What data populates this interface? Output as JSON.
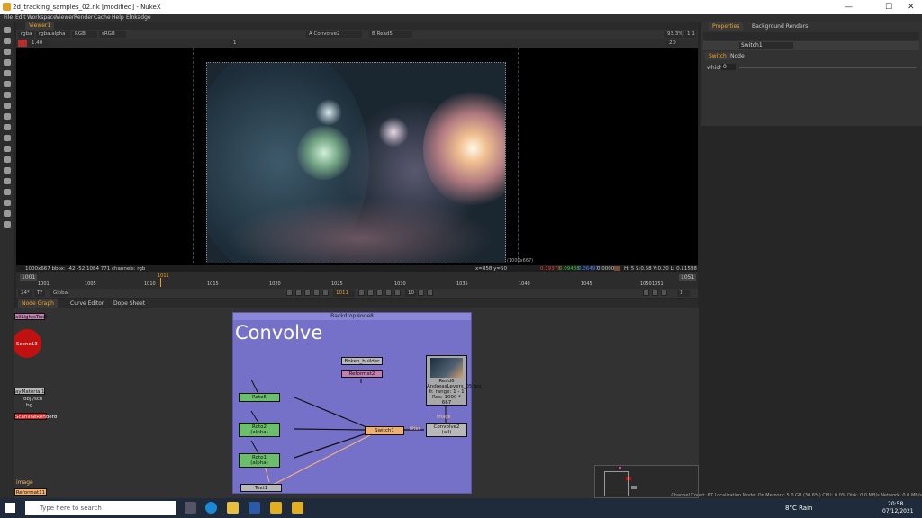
{
  "window": {
    "title": "2d_tracking_samples_02.nk [modified] - NukeX",
    "minimize": "—",
    "maximize": "☐",
    "close": "✕"
  },
  "menu": [
    "File",
    "Edit",
    "Workspace",
    "Viewer",
    "Render",
    "Cache",
    "Help",
    "Elnkadge"
  ],
  "viewer": {
    "tab": "Viewer1",
    "channels": "rgba",
    "alpha": "rgba.alpha",
    "colorspace": "RGB",
    "colorspace2": "sRGB",
    "input_a": "A  Convolve2",
    "input_b": "B  Read5",
    "gain": "1.40",
    "gamma": "1",
    "zoom": "93.3%",
    "ratio": "1:1",
    "view": "2D",
    "info_left": "1000x667  bbox: -42 -52 1084 771  channels: rgb",
    "coords": "x=858 y=50",
    "r": "0.19378",
    "g": "0.09488",
    "b": "0.06497",
    "a": "0.00000",
    "hsv": "H: 5 S:0.58 V:0.20  L: 0.11588",
    "res_label": "(1000x667)"
  },
  "timeline": {
    "start": "1001",
    "end": "1051",
    "current": "1011",
    "fps": "24*",
    "tf": "TF",
    "scope": "Global",
    "step": "10",
    "ticks": [
      "1005",
      "1010",
      "1015",
      "1020",
      "1025",
      "1030",
      "1035",
      "1040",
      "1045",
      "1050"
    ],
    "frame_field": "1011",
    "inc": "1"
  },
  "panels": {
    "node_graph": "Node Graph",
    "curve_editor": "Curve Editor",
    "dope_sheet": "Dope Sheet"
  },
  "backdrop": {
    "label": "BackdropNode8",
    "title": "Convolve"
  },
  "nodes": {
    "bokeh": "Bokeh_builder",
    "reformat": "Reformat2",
    "read": "Read6",
    "read_file": "AndreasLevers_05.jpg",
    "read_range": "fr. range: 1 - 1",
    "read_res": "Res: 1000 * 667",
    "roto5": "Roto5",
    "roto2": "Roto2",
    "roto2b": "(alpha)",
    "roto1": "Roto1",
    "roto1b": "(alpha)",
    "switch": "Switch1",
    "convolve": "Convolve2",
    "convolve_b": "(all)",
    "text": "Text1",
    "image_label": "image",
    "filter_label": "filter"
  },
  "leftnodes": {
    "a": "allLightsTex2",
    "scene": "Scene13",
    "material": "ayMaterial1",
    "obj": "obj /scn",
    "bg": "bg",
    "render": "ScanlineRender8",
    "image": "image",
    "bottom": "Reformat11"
  },
  "properties": {
    "tab1": "Properties",
    "tab2": "Background Renders",
    "node": "Switch1",
    "sub1": "Switch",
    "sub2": "Node",
    "which_label": "which",
    "which_value": "0"
  },
  "status": "Channel Count: 67  Localization Mode: On  Memory: 5.0 GB (30.6%)  CPU: 0.0%  Disk: 0.0 MB/s  Network: 0.0 MB/s",
  "taskbar": {
    "search": "Type here to search",
    "weather": "8°C  Rain",
    "time": "20:58",
    "date": "07/12/2021"
  }
}
